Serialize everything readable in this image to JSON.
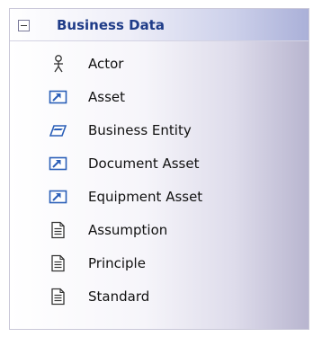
{
  "toolbox": {
    "group_title": "Business Data",
    "items": [
      {
        "label": "Actor",
        "icon": "actor-icon"
      },
      {
        "label": "Asset",
        "icon": "asset-icon"
      },
      {
        "label": "Business Entity",
        "icon": "business-entity-icon"
      },
      {
        "label": "Document Asset",
        "icon": "document-asset-icon"
      },
      {
        "label": "Equipment Asset",
        "icon": "equipment-asset-icon"
      },
      {
        "label": "Assumption",
        "icon": "document-icon"
      },
      {
        "label": "Principle",
        "icon": "document-icon"
      },
      {
        "label": "Standard",
        "icon": "document-icon"
      }
    ]
  },
  "colors": {
    "header_text": "#1f3c88",
    "icon_blue": "#2b5fb8"
  }
}
